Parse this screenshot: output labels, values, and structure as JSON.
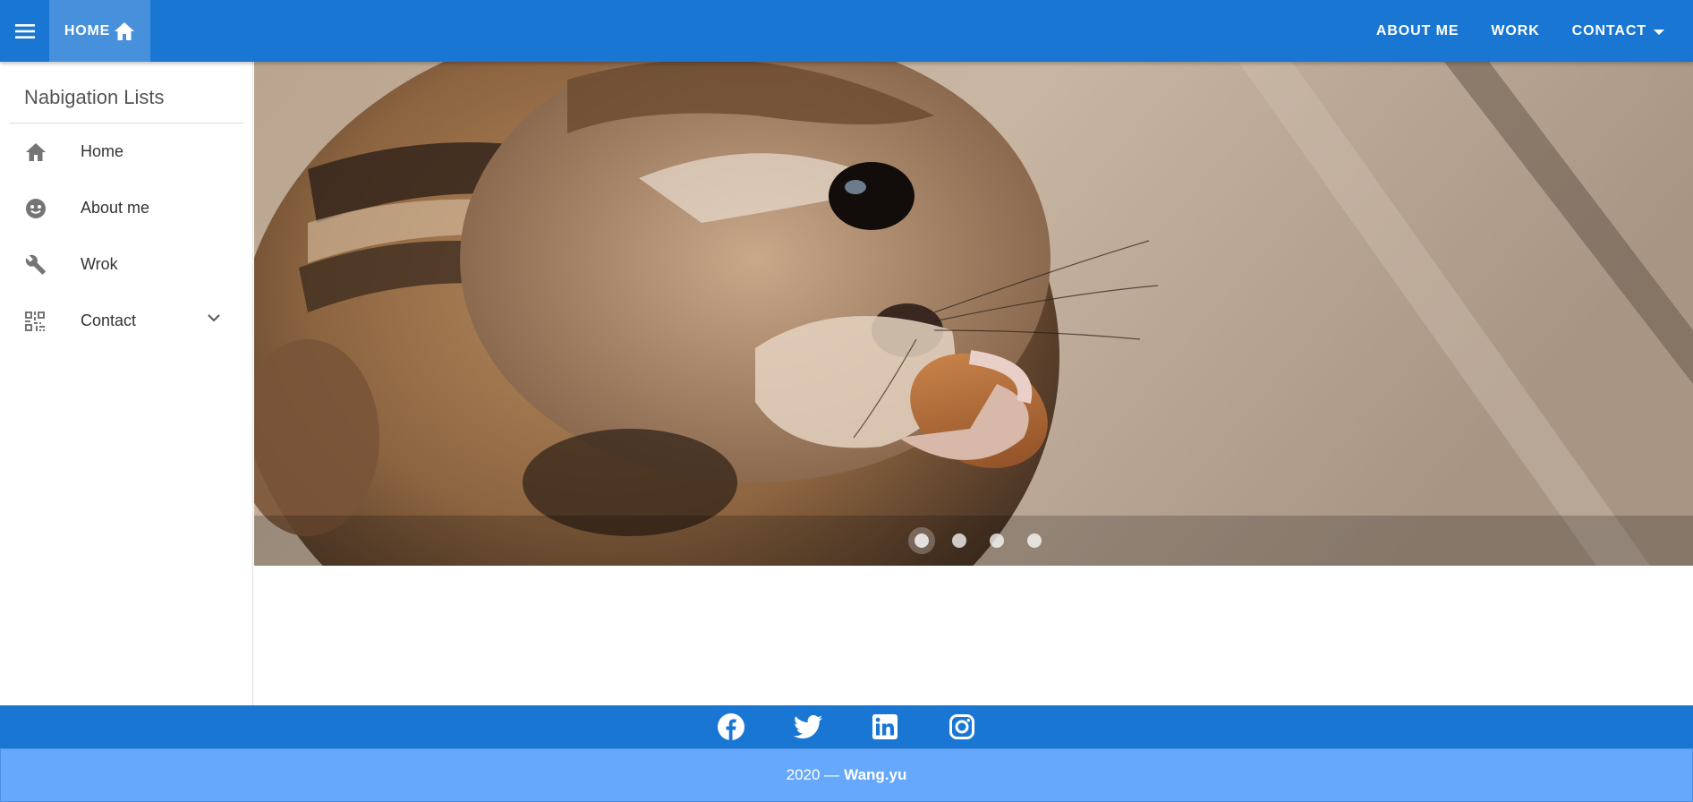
{
  "appbar": {
    "home_label": "HOME",
    "nav": [
      "ABOUT ME",
      "WORK",
      "CONTACT"
    ]
  },
  "sidebar": {
    "title": "Nabigation Lists",
    "items": [
      {
        "label": "Home",
        "icon": "home-icon"
      },
      {
        "label": "About me",
        "icon": "face-icon"
      },
      {
        "label": "Wrok",
        "icon": "wrench-icon"
      },
      {
        "label": "Contact",
        "icon": "qr-code-icon"
      }
    ]
  },
  "carousel": {
    "slides": 4,
    "active_slide": 1
  },
  "footer": {
    "social": [
      "facebook-icon",
      "twitter-icon",
      "linkedin-icon",
      "instagram-icon"
    ],
    "copyright_prefix": "2020 —",
    "author": "Wang.yu"
  },
  "colors": {
    "primary": "#1976d2",
    "footer_light": "#66a8fb"
  }
}
